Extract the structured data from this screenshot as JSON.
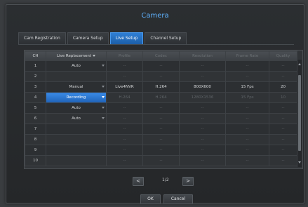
{
  "dialog": {
    "title": "Camera"
  },
  "tabs": [
    {
      "label": "Cam Registration",
      "active": false
    },
    {
      "label": "Camera Setup",
      "active": false
    },
    {
      "label": "Live Setup",
      "active": true
    },
    {
      "label": "Channel Setup",
      "active": false
    }
  ],
  "table": {
    "headers": {
      "ch": "CH",
      "live_replacement": "Live Replacement",
      "profile": "Profile",
      "codec": "Codec",
      "resolution": "Resolution",
      "frame_rate": "Frame Rate",
      "quality": "Quality"
    },
    "rows": [
      {
        "ch": "1",
        "replacement": "Auto",
        "profile": "--",
        "codec": "--",
        "resolution": "--",
        "frame_rate": "--",
        "quality": "--"
      },
      {
        "ch": "2",
        "replacement": "",
        "profile": "--",
        "codec": "--",
        "resolution": "--",
        "frame_rate": "--",
        "quality": "--"
      },
      {
        "ch": "3",
        "replacement": "Manual",
        "profile": "Live4NVR",
        "codec": "H.264",
        "resolution": "800X600",
        "frame_rate": "15 Fps",
        "quality": "20"
      },
      {
        "ch": "4",
        "replacement": "Recording",
        "profile": "H.264",
        "codec": "H.264",
        "resolution": "1280X1536",
        "frame_rate": "15 Fps",
        "quality": "10"
      },
      {
        "ch": "5",
        "replacement": "Auto",
        "profile": "--",
        "codec": "--",
        "resolution": "--",
        "frame_rate": "--",
        "quality": "--"
      },
      {
        "ch": "6",
        "replacement": "Auto",
        "profile": "--",
        "codec": "--",
        "resolution": "--",
        "frame_rate": "--",
        "quality": "--"
      },
      {
        "ch": "7",
        "replacement": "",
        "profile": "--",
        "codec": "--",
        "resolution": "--",
        "frame_rate": "--",
        "quality": "--"
      },
      {
        "ch": "8",
        "replacement": "",
        "profile": "--",
        "codec": "--",
        "resolution": "--",
        "frame_rate": "--",
        "quality": "--"
      },
      {
        "ch": "9",
        "replacement": "",
        "profile": "--",
        "codec": "--",
        "resolution": "--",
        "frame_rate": "--",
        "quality": "--"
      },
      {
        "ch": "10",
        "replacement": "",
        "profile": "--",
        "codec": "--",
        "resolution": "--",
        "frame_rate": "--",
        "quality": "--"
      }
    ]
  },
  "pager": {
    "prev": "<",
    "page": "1/2",
    "next": ">"
  },
  "buttons": {
    "ok": "OK",
    "cancel": "Cancel"
  },
  "colors": {
    "accent": "#5fb3ff",
    "selected": "#2a74d0"
  }
}
